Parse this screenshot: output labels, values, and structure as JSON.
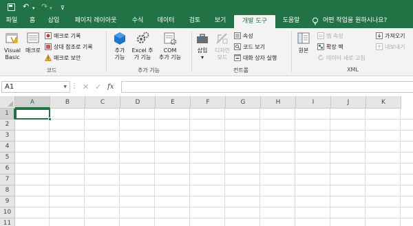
{
  "quick_access": {
    "save_icon": "save-icon",
    "undo_icon": "undo-icon",
    "redo_icon": "redo-icon",
    "undo_glyph": "↶",
    "redo_glyph": "↷",
    "dropdown_glyph": "▾",
    "customize_glyph": "⊽"
  },
  "tabs": [
    {
      "label": "파일",
      "active": false
    },
    {
      "label": "홈",
      "active": false
    },
    {
      "label": "삽입",
      "active": false
    },
    {
      "label": "페이지 레이아웃",
      "active": false
    },
    {
      "label": "수식",
      "active": false
    },
    {
      "label": "데이터",
      "active": false
    },
    {
      "label": "검토",
      "active": false
    },
    {
      "label": "보기",
      "active": false
    },
    {
      "label": "개발 도구",
      "active": true
    },
    {
      "label": "도움말",
      "active": false
    }
  ],
  "tell_me": {
    "text": "어떤 작업을 원하시나요?",
    "icon": "lightbulb-icon"
  },
  "ribbon": {
    "code": {
      "label": "코드",
      "visual_basic": "Visual Basic",
      "macro": "매크로",
      "record_macro": "매크로 기록",
      "relative_refs": "상대 참조로 기록",
      "macro_security": "매크로 보안"
    },
    "addins": {
      "label": "추가 기능",
      "addins_line1": "추가",
      "addins_line2": "기능",
      "excel_line1": "Excel 추",
      "excel_line2": "가 기능",
      "com_line1": "COM",
      "com_line2": "추가 기능"
    },
    "controls": {
      "label": "컨트롤",
      "insert": "삽입",
      "insert_drop": "▾",
      "design_line1": "디자인",
      "design_line2": "모드",
      "properties": "속성",
      "view_code": "코드 보기",
      "run_dialog": "대화 상자 실행"
    },
    "xml": {
      "label": "XML",
      "source": "원본",
      "map_properties": "맵 속성",
      "expansion_packs": "확장 팩",
      "refresh_data": "데이터 새로 고침",
      "import": "가져오기",
      "export": "내보내기"
    }
  },
  "formula_bar": {
    "name_box": "A1",
    "cancel": "✕",
    "enter": "✓",
    "fx": "fx",
    "formula": ""
  },
  "grid": {
    "columns": [
      "A",
      "B",
      "C",
      "D",
      "E",
      "F",
      "G",
      "H",
      "I",
      "J",
      "K"
    ],
    "rows": [
      "1",
      "2",
      "3",
      "4",
      "5",
      "6",
      "7",
      "8",
      "9",
      "10",
      "11"
    ],
    "selected_cell": "A1"
  },
  "colors": {
    "accent": "#217346",
    "ribbon_bg": "#f3f3f3",
    "header_bg": "#e6e6e6",
    "gridline": "#d9d9d9"
  }
}
